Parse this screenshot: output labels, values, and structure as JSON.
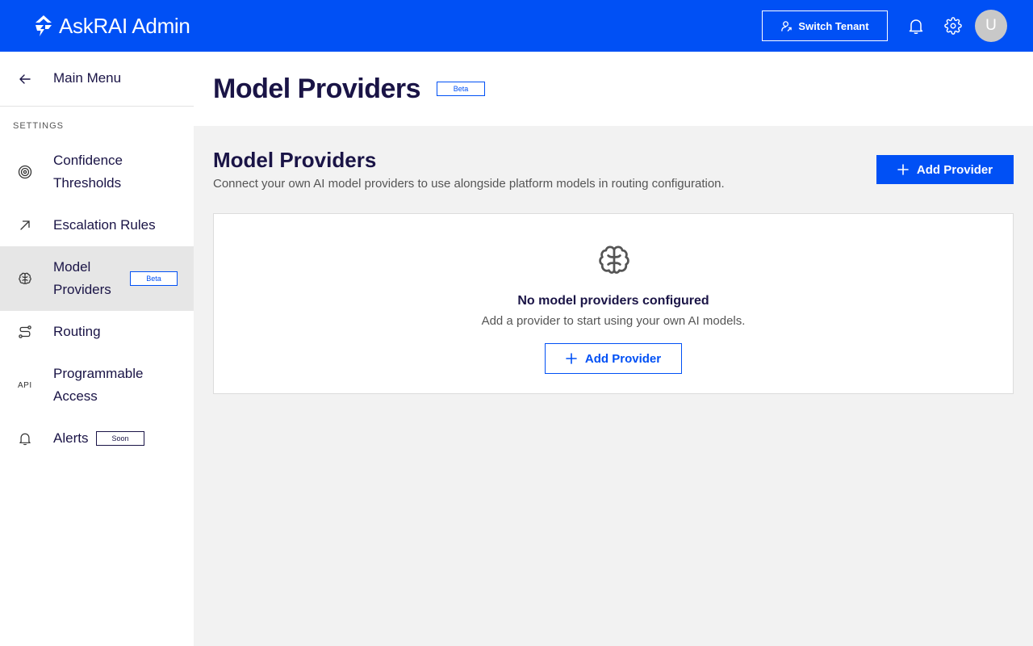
{
  "app": {
    "title": "AskRAI Admin",
    "brand_color": "#0050f5",
    "text_color": "#1a1446"
  },
  "topbar": {
    "switch_tenant_label": "Switch Tenant",
    "avatar_initial": "U"
  },
  "sidebar": {
    "main_menu_label": "Main Menu",
    "section_label": "SETTINGS",
    "items": [
      {
        "label_line1": "Confidence",
        "label_line2": "Thresholds",
        "icon": "target-icon"
      },
      {
        "label": "Escalation Rules",
        "icon": "arrow-up-right-icon"
      },
      {
        "label_line1": "Model",
        "label_line2": "Providers",
        "icon": "brain-icon",
        "badge": "Beta",
        "active": true
      },
      {
        "label": "Routing",
        "icon": "route-icon"
      },
      {
        "label_line1": "Programmable",
        "label_line2": "Access",
        "icon_text": "API"
      },
      {
        "label": "Alerts",
        "icon": "bell-icon",
        "badge": "Soon"
      }
    ]
  },
  "page": {
    "title": "Model Providers",
    "badge": "Beta"
  },
  "content": {
    "title": "Model Providers",
    "subtitle": "Connect your own AI model providers to use alongside platform models in routing configuration.",
    "add_button_label": "Add Provider",
    "empty_state": {
      "title": "No model providers configured",
      "subtitle": "Add a provider to start using your own AI models.",
      "button_label": "Add Provider",
      "icon": "brain-icon"
    }
  }
}
